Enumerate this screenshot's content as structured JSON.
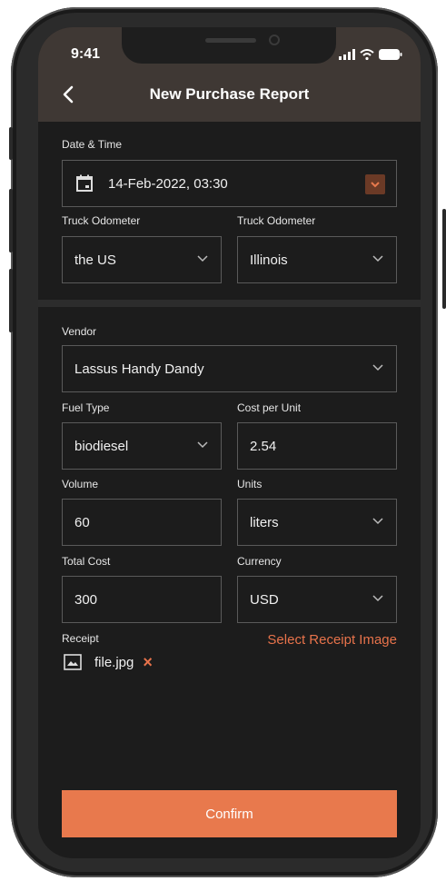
{
  "status_bar": {
    "time": "9:41"
  },
  "header": {
    "title": "New Purchase Report"
  },
  "date_time": {
    "label": "Date & Time",
    "value": "14-Feb-2022, 03:30"
  },
  "odometer_left": {
    "label": "Truck Odometer",
    "value": "the US"
  },
  "odometer_right": {
    "label": "Truck Odometer",
    "value": "Illinois"
  },
  "vendor": {
    "label": "Vendor",
    "value": "Lassus Handy Dandy"
  },
  "fuel_type": {
    "label": "Fuel Type",
    "value": "biodiesel"
  },
  "cost_per_unit": {
    "label": "Cost per Unit",
    "value": "2.54"
  },
  "volume": {
    "label": "Volume",
    "value": "60"
  },
  "units": {
    "label": "Units",
    "value": "liters"
  },
  "total_cost": {
    "label": "Total Cost",
    "value": "300"
  },
  "currency": {
    "label": "Currency",
    "value": "USD"
  },
  "receipt": {
    "label": "Receipt",
    "select_link": "Select Receipt Image",
    "file_name": "file.jpg",
    "remove_glyph": "×"
  },
  "confirm": {
    "label": "Confirm"
  },
  "colors": {
    "accent": "#e8794d",
    "header_bg": "#3f3834",
    "screen_bg": "#1c1c1c"
  }
}
